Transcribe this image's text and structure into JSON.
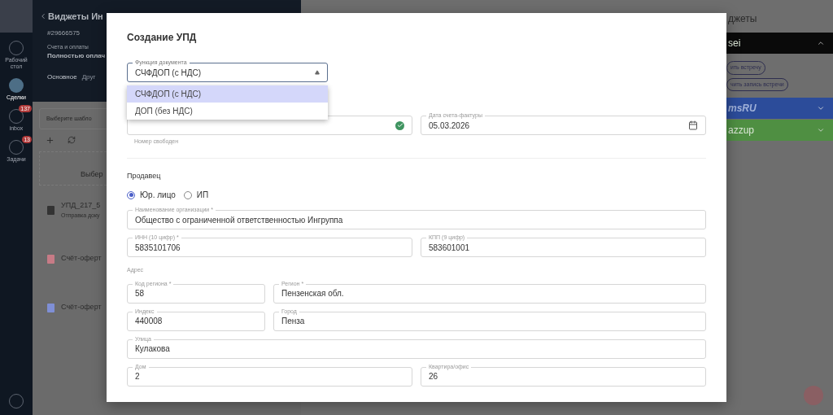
{
  "nav": [
    {
      "label": "Рабочий стол",
      "selected": false
    },
    {
      "label": "Сделки",
      "selected": true
    },
    {
      "label": "inbox",
      "selected": false,
      "badge": "137"
    },
    {
      "label": "Задачи",
      "selected": false,
      "badge": "13"
    }
  ],
  "deal": {
    "title": "Виджеты Ин",
    "number": "#29666575",
    "pipeline": "Счета и оплаты",
    "stage": "Полностью оплач",
    "tabs": [
      {
        "label": "Основное",
        "selected": true
      },
      {
        "label": "Друг",
        "selected": false
      }
    ],
    "template_placeholder": "Выберите шабло",
    "drop_text": "Выбер",
    "documents": [
      {
        "name": "УПД_217_5",
        "subtitle": "Отправка доку",
        "color": "#333333"
      },
      {
        "name": "Счёт-оферт",
        "color": "#c77b86"
      },
      {
        "name": "Счёт-оферт",
        "color": "#7f8fd6"
      }
    ]
  },
  "widgets": {
    "title": "джеты",
    "panels": [
      {
        "name": "sei",
        "color": "#0a0a0a",
        "expanded": true,
        "actions": [
          "ить встречу",
          "чить запись встречи"
        ]
      },
      {
        "name": "msRU",
        "color": "#2c4c9a",
        "expanded": false
      },
      {
        "name": "azzup",
        "color": "#4f8f42",
        "expanded": false
      }
    ]
  },
  "modal": {
    "title": "Создание УПД",
    "doc_function": {
      "label": "Функция документа",
      "value": "СЧФДОП (с НДС)",
      "expanded": true,
      "options": [
        {
          "label": "СЧФДОП (с НДС)",
          "selected": true
        },
        {
          "label": "ДОП (без НДС)",
          "selected": false
        }
      ]
    },
    "number": {
      "valid": true,
      "helper": "Номер свободен"
    },
    "date": {
      "label": "Дата счета-фактуры",
      "value": "05.03.2026"
    },
    "seller_title": "Продавец",
    "seller_types": [
      {
        "label": "Юр. лицо",
        "selected": true
      },
      {
        "label": "ИП",
        "selected": false
      }
    ],
    "org": {
      "label": "Наименование организации *",
      "value": "Общество с ограниченной ответственностью Ингруппа"
    },
    "inn": {
      "label": "ИНН (10 цифр) *",
      "value": "5835101706"
    },
    "kpp": {
      "label": "КПП (9 цифр)",
      "value": "583601001"
    },
    "address_title": "Адрес",
    "address_rows": [
      [
        {
          "label": "Код региона *",
          "value": "58",
          "kind": "narrow"
        },
        {
          "label": "Регион *",
          "value": "Пензенская обл.",
          "kind": "wide"
        }
      ],
      [
        {
          "label": "Индекс",
          "value": "440008",
          "kind": "narrow"
        },
        {
          "label": "Город",
          "value": "Пенза",
          "kind": "wide"
        }
      ],
      [
        {
          "label": "Улица",
          "value": "Кулакова",
          "kind": "full"
        }
      ],
      [
        {
          "label": "Дом",
          "value": "2",
          "kind": "half"
        },
        {
          "label": "Квартира/офис",
          "value": "26",
          "kind": "half"
        }
      ]
    ]
  }
}
